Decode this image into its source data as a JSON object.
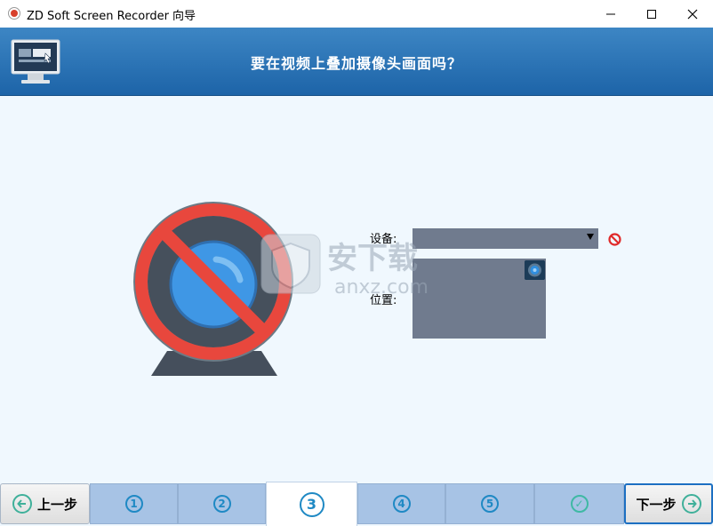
{
  "window": {
    "title": "ZD Soft Screen Recorder 向导",
    "minimize_glyph": "—",
    "maximize_glyph": "☐",
    "close_glyph": "✕"
  },
  "header": {
    "title": "要在视频上叠加摄像头画面吗？",
    "background_color": "#2b74b8"
  },
  "content": {
    "device_label": "设备:",
    "device_value": "",
    "position_label": "位置:",
    "webcam_icon": "webcam-disabled-icon",
    "disable_icon": "no-entry-icon"
  },
  "watermark": {
    "text_cn": "安下载",
    "text_en": "anxz.com"
  },
  "nav": {
    "prev_label": "上一步",
    "next_label": "下一步",
    "steps": [
      "1",
      "2",
      "3",
      "4",
      "5",
      "✓"
    ],
    "active_step": "3",
    "accent_color": "#1f89c4"
  }
}
